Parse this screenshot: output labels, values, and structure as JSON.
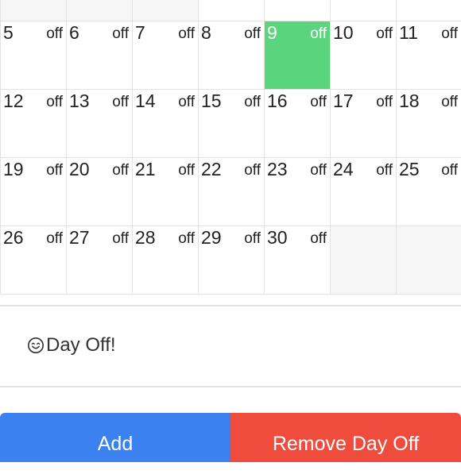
{
  "calendar": {
    "off_label": "off",
    "selected_day": "9",
    "weeks": [
      [
        null,
        null,
        null,
        null,
        null,
        null,
        null
      ],
      [
        "5",
        "6",
        "7",
        "8",
        "9",
        "10",
        "11"
      ],
      [
        "12",
        "13",
        "14",
        "15",
        "16",
        "17",
        "18"
      ],
      [
        "19",
        "20",
        "21",
        "22",
        "23",
        "24",
        "25"
      ],
      [
        "26",
        "27",
        "28",
        "29",
        "30",
        null,
        null
      ]
    ],
    "colors": {
      "selected": "#5bd47e",
      "empty": "#f6f6f6",
      "grid": "#e3e3e3"
    }
  },
  "note": {
    "icon": "smile-icon",
    "text": "Day Off!"
  },
  "actions": {
    "add_label": "Add",
    "remove_label": "Remove Day Off",
    "add_color": "#3b82f0",
    "remove_color": "#ef4c3d"
  }
}
